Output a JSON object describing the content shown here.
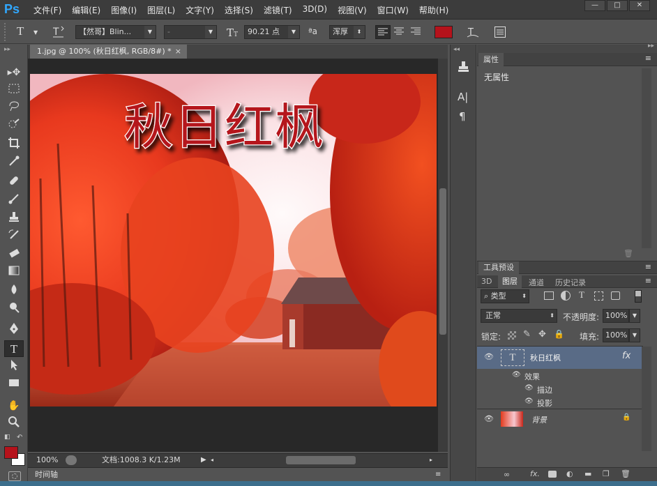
{
  "app": {
    "logo": "Ps"
  },
  "menu": [
    "文件(F)",
    "编辑(E)",
    "图像(I)",
    "图层(L)",
    "文字(Y)",
    "选择(S)",
    "滤镜(T)",
    "3D(D)",
    "视图(V)",
    "窗口(W)",
    "帮助(H)"
  ],
  "window_controls": [
    "—",
    "□",
    "✕"
  ],
  "options_bar": {
    "tool_icon": "T",
    "font_family": "【然哥】Blin...",
    "font_style": "-",
    "font_size": "90.21 点",
    "aa_label": "ªa",
    "anti_alias": "浑厚",
    "text_color": "#b5121b"
  },
  "document": {
    "tab_title": "1.jpg @ 100% (秋日红枫, RGB/8#) *",
    "canvas_text": "秋日红枫",
    "zoom": "100%",
    "doc_size": "文档:1008.3 K/1.23M"
  },
  "timeline_label": "时间轴",
  "panels": {
    "properties": {
      "tab": "属性",
      "content": "无属性"
    },
    "tool_presets": {
      "tab": "工具预设"
    },
    "layers": {
      "tabs": [
        "3D",
        "图层",
        "通道",
        "历史记录"
      ],
      "kind_filter": "类型",
      "blend_mode": "正常",
      "opacity_label": "不透明度:",
      "opacity": "100%",
      "lock_label": "锁定:",
      "fill_label": "填充:",
      "fill": "100%",
      "items": [
        {
          "name": "秋日红枫",
          "type": "text",
          "fx": "fx"
        },
        {
          "name": "效果"
        },
        {
          "name": "描边"
        },
        {
          "name": "投影"
        },
        {
          "name": "背景"
        }
      ]
    }
  },
  "colors": {
    "foreground": "#b5121b",
    "background": "#ffffff",
    "accent": "#3c6e8c"
  }
}
